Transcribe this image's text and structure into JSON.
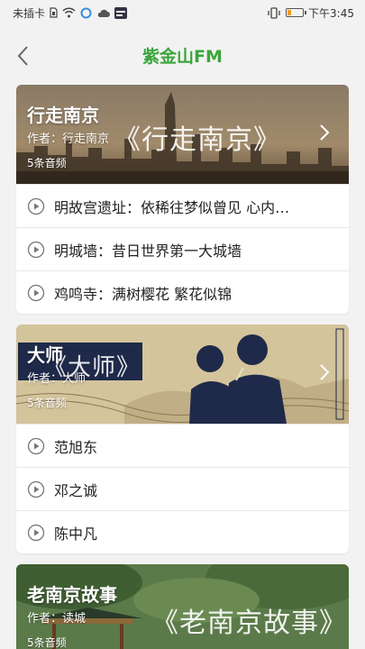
{
  "status_bar": {
    "carrier": "未插卡",
    "time": "下午3:45",
    "battery_level_percent": 25,
    "icons": [
      "sim-card-icon",
      "wifi-icon",
      "data-saver-icon",
      "cloud-icon",
      "notification-app-icon",
      "vibrate-icon",
      "battery-icon"
    ]
  },
  "nav": {
    "title": "紫金山FM",
    "back_icon": "chevron-left-icon",
    "title_color": "#3aa53a"
  },
  "sections": [
    {
      "title": "行走南京",
      "author": "作者：行走南京",
      "count": "5条音频",
      "banner_art_text": "《行走南京》",
      "items": [
        {
          "label": "明故宫遗址：依稀往梦似曾见  心内…"
        },
        {
          "label": "明城墙：昔日世界第一大城墙"
        },
        {
          "label": "鸡鸣寺：满树樱花  繁花似锦"
        }
      ]
    },
    {
      "title": "大师",
      "author": "作者：大师",
      "count": "5条音频",
      "banner_art_text": "《大师》",
      "items": [
        {
          "label": "范旭东"
        },
        {
          "label": "邓之诚"
        },
        {
          "label": "陈中凡"
        }
      ]
    },
    {
      "title": "老南京故事",
      "author": "作者：读城",
      "count": "5条音频",
      "banner_art_text": "《老南京故事》",
      "items": []
    }
  ]
}
